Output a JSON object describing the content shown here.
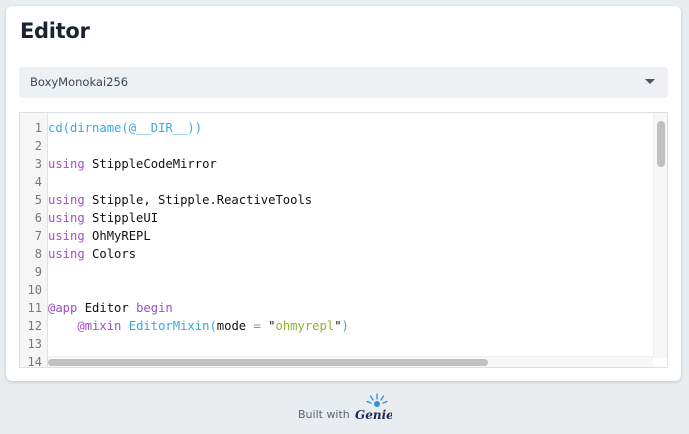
{
  "card": {
    "title": "Editor"
  },
  "theme_select": {
    "selected": "BoxyMonokai256"
  },
  "editor": {
    "lines": [
      {
        "n": "1",
        "tokens": [
          {
            "t": "cd(dirname(",
            "c": "fn"
          },
          {
            "t": "@__DIR__",
            "c": "sym"
          },
          {
            "t": "))",
            "c": "fn"
          }
        ]
      },
      {
        "n": "2",
        "tokens": []
      },
      {
        "n": "3",
        "tokens": [
          {
            "t": "using",
            "c": "kw"
          },
          {
            "t": " StippleCodeMirror",
            "c": ""
          }
        ]
      },
      {
        "n": "4",
        "tokens": []
      },
      {
        "n": "5",
        "tokens": [
          {
            "t": "using",
            "c": "kw"
          },
          {
            "t": " Stipple, Stipple.ReactiveTools",
            "c": ""
          }
        ]
      },
      {
        "n": "6",
        "tokens": [
          {
            "t": "using",
            "c": "kw"
          },
          {
            "t": " StippleUI",
            "c": ""
          }
        ]
      },
      {
        "n": "7",
        "tokens": [
          {
            "t": "using",
            "c": "kw"
          },
          {
            "t": " OhMyREPL",
            "c": ""
          }
        ]
      },
      {
        "n": "8",
        "tokens": [
          {
            "t": "using",
            "c": "kw"
          },
          {
            "t": " Colors",
            "c": ""
          }
        ]
      },
      {
        "n": "9",
        "tokens": []
      },
      {
        "n": "10",
        "tokens": []
      },
      {
        "n": "11",
        "tokens": [
          {
            "t": "@app",
            "c": "mac"
          },
          {
            "t": " Editor ",
            "c": ""
          },
          {
            "t": "begin",
            "c": "kw"
          }
        ]
      },
      {
        "n": "12",
        "tokens": [
          {
            "t": "    ",
            "c": ""
          },
          {
            "t": "@mixin",
            "c": "mac"
          },
          {
            "t": " EditorMixin(",
            "c": "fn"
          },
          {
            "t": "mode",
            "c": ""
          },
          {
            "t": " = ",
            "c": "op"
          },
          {
            "t": "\"",
            "c": ""
          },
          {
            "t": "ohmyrepl",
            "c": "str"
          },
          {
            "t": "\"",
            "c": ""
          },
          {
            "t": ")",
            "c": "fn"
          }
        ]
      },
      {
        "n": "13",
        "tokens": []
      },
      {
        "n": "14",
        "tokens": []
      }
    ]
  },
  "footer": {
    "built_with": "Built with",
    "logo_text": "Genie"
  },
  "colors": {
    "keyword": "#a04fc3",
    "function": "#35a8e0",
    "string": "#8ab52a",
    "background": "#e9edef"
  },
  "icons": {
    "select_caret": "caret-down-icon",
    "logo": "genie-logo-icon"
  }
}
